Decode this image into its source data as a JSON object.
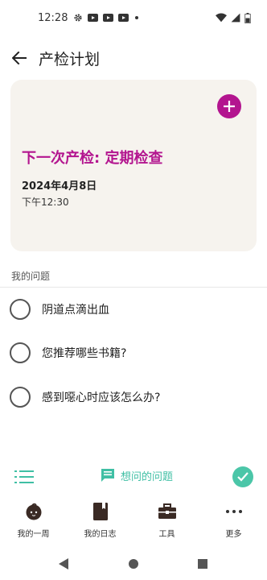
{
  "status_bar": {
    "time": "12:28",
    "icons": [
      "settings-icon",
      "youtube-icon",
      "youtube-icon",
      "youtube-icon",
      "notification-dot-icon",
      "wifi-icon",
      "signal-icon",
      "battery-icon"
    ]
  },
  "app_bar": {
    "title": "产检计划",
    "back_icon": "arrow-left-icon"
  },
  "next_checkup": {
    "title": "下一次产检: 定期检查",
    "date": "2024年4月8日",
    "time": "下午12:30",
    "add_icon": "plus-icon"
  },
  "questions": {
    "section_title": "我的问题",
    "items": [
      {
        "text": "阴道点滴出血"
      },
      {
        "text": "您推荐哪些书籍?"
      },
      {
        "text": "感到噁心时应该怎么办?"
      }
    ]
  },
  "toolbar": {
    "list_icon": "list-icon",
    "ask_label": "想问的问题",
    "ask_icon": "chat-bubble-icon",
    "check_icon": "check-icon"
  },
  "bottom_nav": {
    "items": [
      {
        "label": "我的一周",
        "icon": "baby-face-icon"
      },
      {
        "label": "我的日志",
        "icon": "journal-icon"
      },
      {
        "label": "工具",
        "icon": "toolbox-icon"
      },
      {
        "label": "更多",
        "icon": "more-icon"
      }
    ]
  },
  "colors": {
    "accent": "#b3158f",
    "teal": "#4bc6a8",
    "card_bg": "#f6f3ee"
  }
}
